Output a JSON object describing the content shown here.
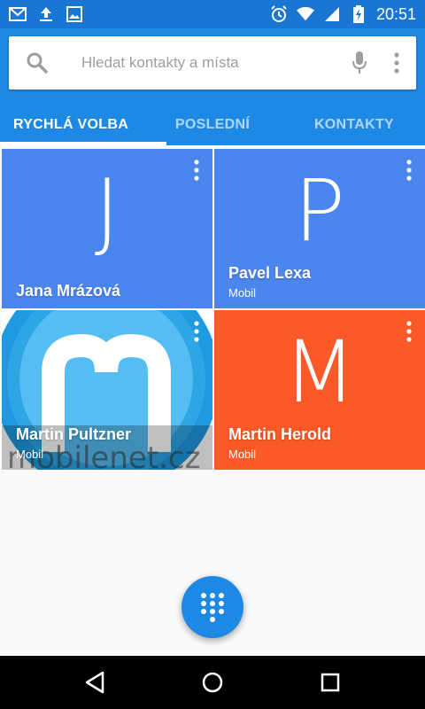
{
  "status_bar": {
    "time": "20:51",
    "icons": [
      "gmail-icon",
      "upload-icon",
      "image-icon",
      "alarm-icon",
      "wifi-icon",
      "signal-icon",
      "battery-charging-icon"
    ]
  },
  "search": {
    "placeholder": "Hledat kontakty a místa"
  },
  "tabs": [
    {
      "label": "RYCHLÁ VOLBA",
      "active": true
    },
    {
      "label": "POSLEDNÍ",
      "active": false
    },
    {
      "label": "KONTAKTY",
      "active": false
    }
  ],
  "contacts": [
    {
      "initial": "J",
      "name": "Jana Mrázová",
      "type": "",
      "color": "#4b86ee"
    },
    {
      "initial": "P",
      "name": "Pavel Lexa",
      "type": "Mobil",
      "color": "#4b86ee"
    },
    {
      "initial": "",
      "name": "Martin Pultzner",
      "type": "Mobil",
      "color": "#2a9fe0",
      "photo_watermark": "mobilenet.cz"
    },
    {
      "initial": "M",
      "name": "Martin Herold",
      "type": "Mobil",
      "color": "#fb5a28"
    }
  ],
  "colors": {
    "status_bar": "#1976d2",
    "header": "#1e88e5",
    "tile_blue": "#4b86ee",
    "tile_orange": "#fb5a28",
    "fab": "#1e88e5"
  },
  "fab": {
    "icon": "dialpad-icon"
  },
  "navbar": {
    "icons": [
      "back-icon",
      "home-icon",
      "recents-icon"
    ]
  }
}
